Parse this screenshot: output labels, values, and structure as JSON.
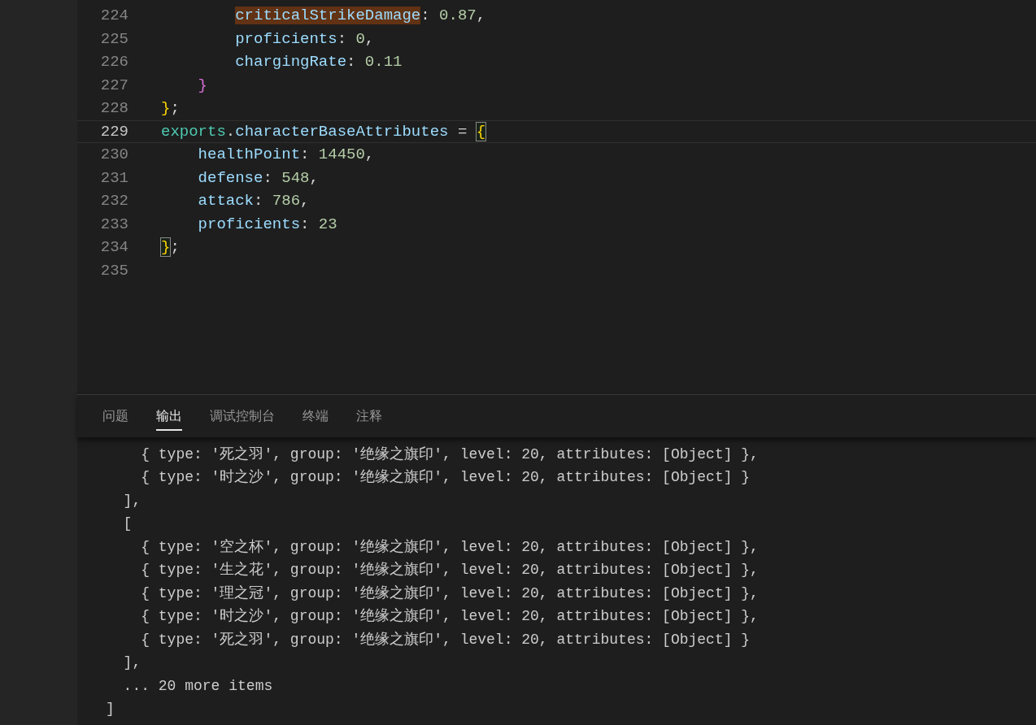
{
  "editor": {
    "lines": [
      {
        "number": "224",
        "current": false,
        "tokens": [
          {
            "kind": "property",
            "text": "        criticalStrikeDamage",
            "highlighted": true
          },
          {
            "kind": "punct",
            "text": ": "
          },
          {
            "kind": "number",
            "text": "0.87"
          },
          {
            "kind": "punct",
            "text": ","
          }
        ]
      },
      {
        "number": "225",
        "current": false,
        "tokens": [
          {
            "kind": "property",
            "text": "        proficients"
          },
          {
            "kind": "punct",
            "text": ": "
          },
          {
            "kind": "number",
            "text": "0"
          },
          {
            "kind": "punct",
            "text": ","
          }
        ]
      },
      {
        "number": "226",
        "current": false,
        "tokens": [
          {
            "kind": "property",
            "text": "        chargingRate"
          },
          {
            "kind": "punct",
            "text": ": "
          },
          {
            "kind": "number",
            "text": "0.11"
          }
        ]
      },
      {
        "number": "227",
        "current": false,
        "tokens": [
          {
            "kind": "brace2",
            "text": "    }"
          }
        ]
      },
      {
        "number": "228",
        "current": false,
        "tokens": [
          {
            "kind": "brace1",
            "text": "}"
          },
          {
            "kind": "punct",
            "text": ";"
          }
        ]
      },
      {
        "number": "229",
        "current": true,
        "tokens": [
          {
            "kind": "module",
            "text": "exports"
          },
          {
            "kind": "punct",
            "text": "."
          },
          {
            "kind": "property",
            "text": "characterBaseAttributes"
          },
          {
            "kind": "punct",
            "text": " = "
          },
          {
            "kind": "brace1",
            "text": "{",
            "bracket_match": true
          }
        ]
      },
      {
        "number": "230",
        "current": false,
        "tokens": [
          {
            "kind": "property",
            "text": "    healthPoint"
          },
          {
            "kind": "punct",
            "text": ": "
          },
          {
            "kind": "number",
            "text": "14450"
          },
          {
            "kind": "punct",
            "text": ","
          }
        ]
      },
      {
        "number": "231",
        "current": false,
        "tokens": [
          {
            "kind": "property",
            "text": "    defense"
          },
          {
            "kind": "punct",
            "text": ": "
          },
          {
            "kind": "number",
            "text": "548"
          },
          {
            "kind": "punct",
            "text": ","
          }
        ]
      },
      {
        "number": "232",
        "current": false,
        "tokens": [
          {
            "kind": "property",
            "text": "    attack"
          },
          {
            "kind": "punct",
            "text": ": "
          },
          {
            "kind": "number",
            "text": "786"
          },
          {
            "kind": "punct",
            "text": ","
          }
        ]
      },
      {
        "number": "233",
        "current": false,
        "tokens": [
          {
            "kind": "property",
            "text": "    proficients"
          },
          {
            "kind": "punct",
            "text": ": "
          },
          {
            "kind": "number",
            "text": "23"
          }
        ]
      },
      {
        "number": "234",
        "current": false,
        "tokens": [
          {
            "kind": "brace1",
            "text": "}",
            "bracket_match": true
          },
          {
            "kind": "punct",
            "text": ";"
          }
        ]
      },
      {
        "number": "235",
        "current": false
      }
    ]
  },
  "panel": {
    "tabs": [
      {
        "label": "问题",
        "selected": false
      },
      {
        "label": "输出",
        "selected": true
      },
      {
        "label": "调试控制台",
        "selected": false
      },
      {
        "label": "终端",
        "selected": false
      },
      {
        "label": "注释",
        "selected": false
      }
    ],
    "output": [
      "    { type: '死之羽', group: '绝缘之旗印', level: 20, attributes: [Object] },",
      "    { type: '时之沙', group: '绝缘之旗印', level: 20, attributes: [Object] }",
      "  ],",
      "  [",
      "    { type: '空之杯', group: '绝缘之旗印', level: 20, attributes: [Object] },",
      "    { type: '生之花', group: '绝缘之旗印', level: 20, attributes: [Object] },",
      "    { type: '理之冠', group: '绝缘之旗印', level: 20, attributes: [Object] },",
      "    { type: '时之沙', group: '绝缘之旗印', level: 20, attributes: [Object] },",
      "    { type: '死之羽', group: '绝缘之旗印', level: 20, attributes: [Object] }",
      "  ],",
      "  ... 20 more items",
      "]"
    ]
  }
}
